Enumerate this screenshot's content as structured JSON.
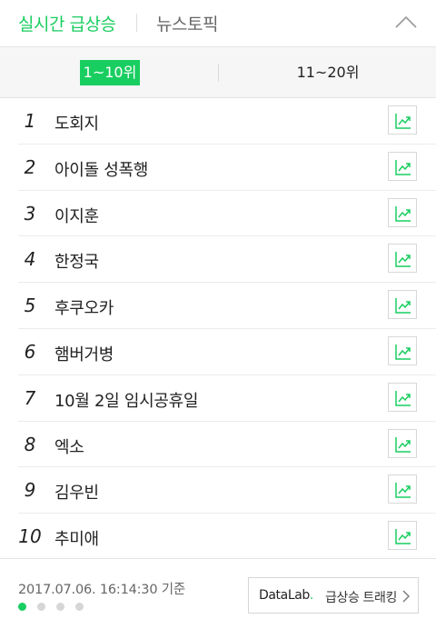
{
  "header": {
    "tab_main": "실시간 급상승",
    "tab_sub": "뉴스토픽",
    "collapse_icon": "chevron-up-icon"
  },
  "range_tabs": [
    {
      "label": "1~10위",
      "active": true
    },
    {
      "label": "11~20위",
      "active": false
    }
  ],
  "ranks": [
    {
      "rank": "1",
      "keyword": "도회지"
    },
    {
      "rank": "2",
      "keyword": "아이돌 성폭행"
    },
    {
      "rank": "3",
      "keyword": "이지훈"
    },
    {
      "rank": "4",
      "keyword": "한정국"
    },
    {
      "rank": "5",
      "keyword": "후쿠오카"
    },
    {
      "rank": "6",
      "keyword": "햄버거병"
    },
    {
      "rank": "7",
      "keyword": "10월 2일 임시공휴일"
    },
    {
      "rank": "8",
      "keyword": "엑소"
    },
    {
      "rank": "9",
      "keyword": "김우빈"
    },
    {
      "rank": "10",
      "keyword": "추미애"
    }
  ],
  "trend_icon": "trend-chart-icon",
  "footer": {
    "timestamp": "2017.07.06. 16:14:30 기준",
    "pagination": {
      "total": 4,
      "active": 1
    },
    "datalab": {
      "brand_1": "DataLab",
      "brand_2": ".",
      "label": "급상승 트래킹",
      "chevron": ">"
    }
  },
  "colors": {
    "accent": "#19ce60",
    "text": "#222222",
    "muted": "#666666",
    "border": "#e4e4e4",
    "bar_bg": "#f6f6f6"
  }
}
